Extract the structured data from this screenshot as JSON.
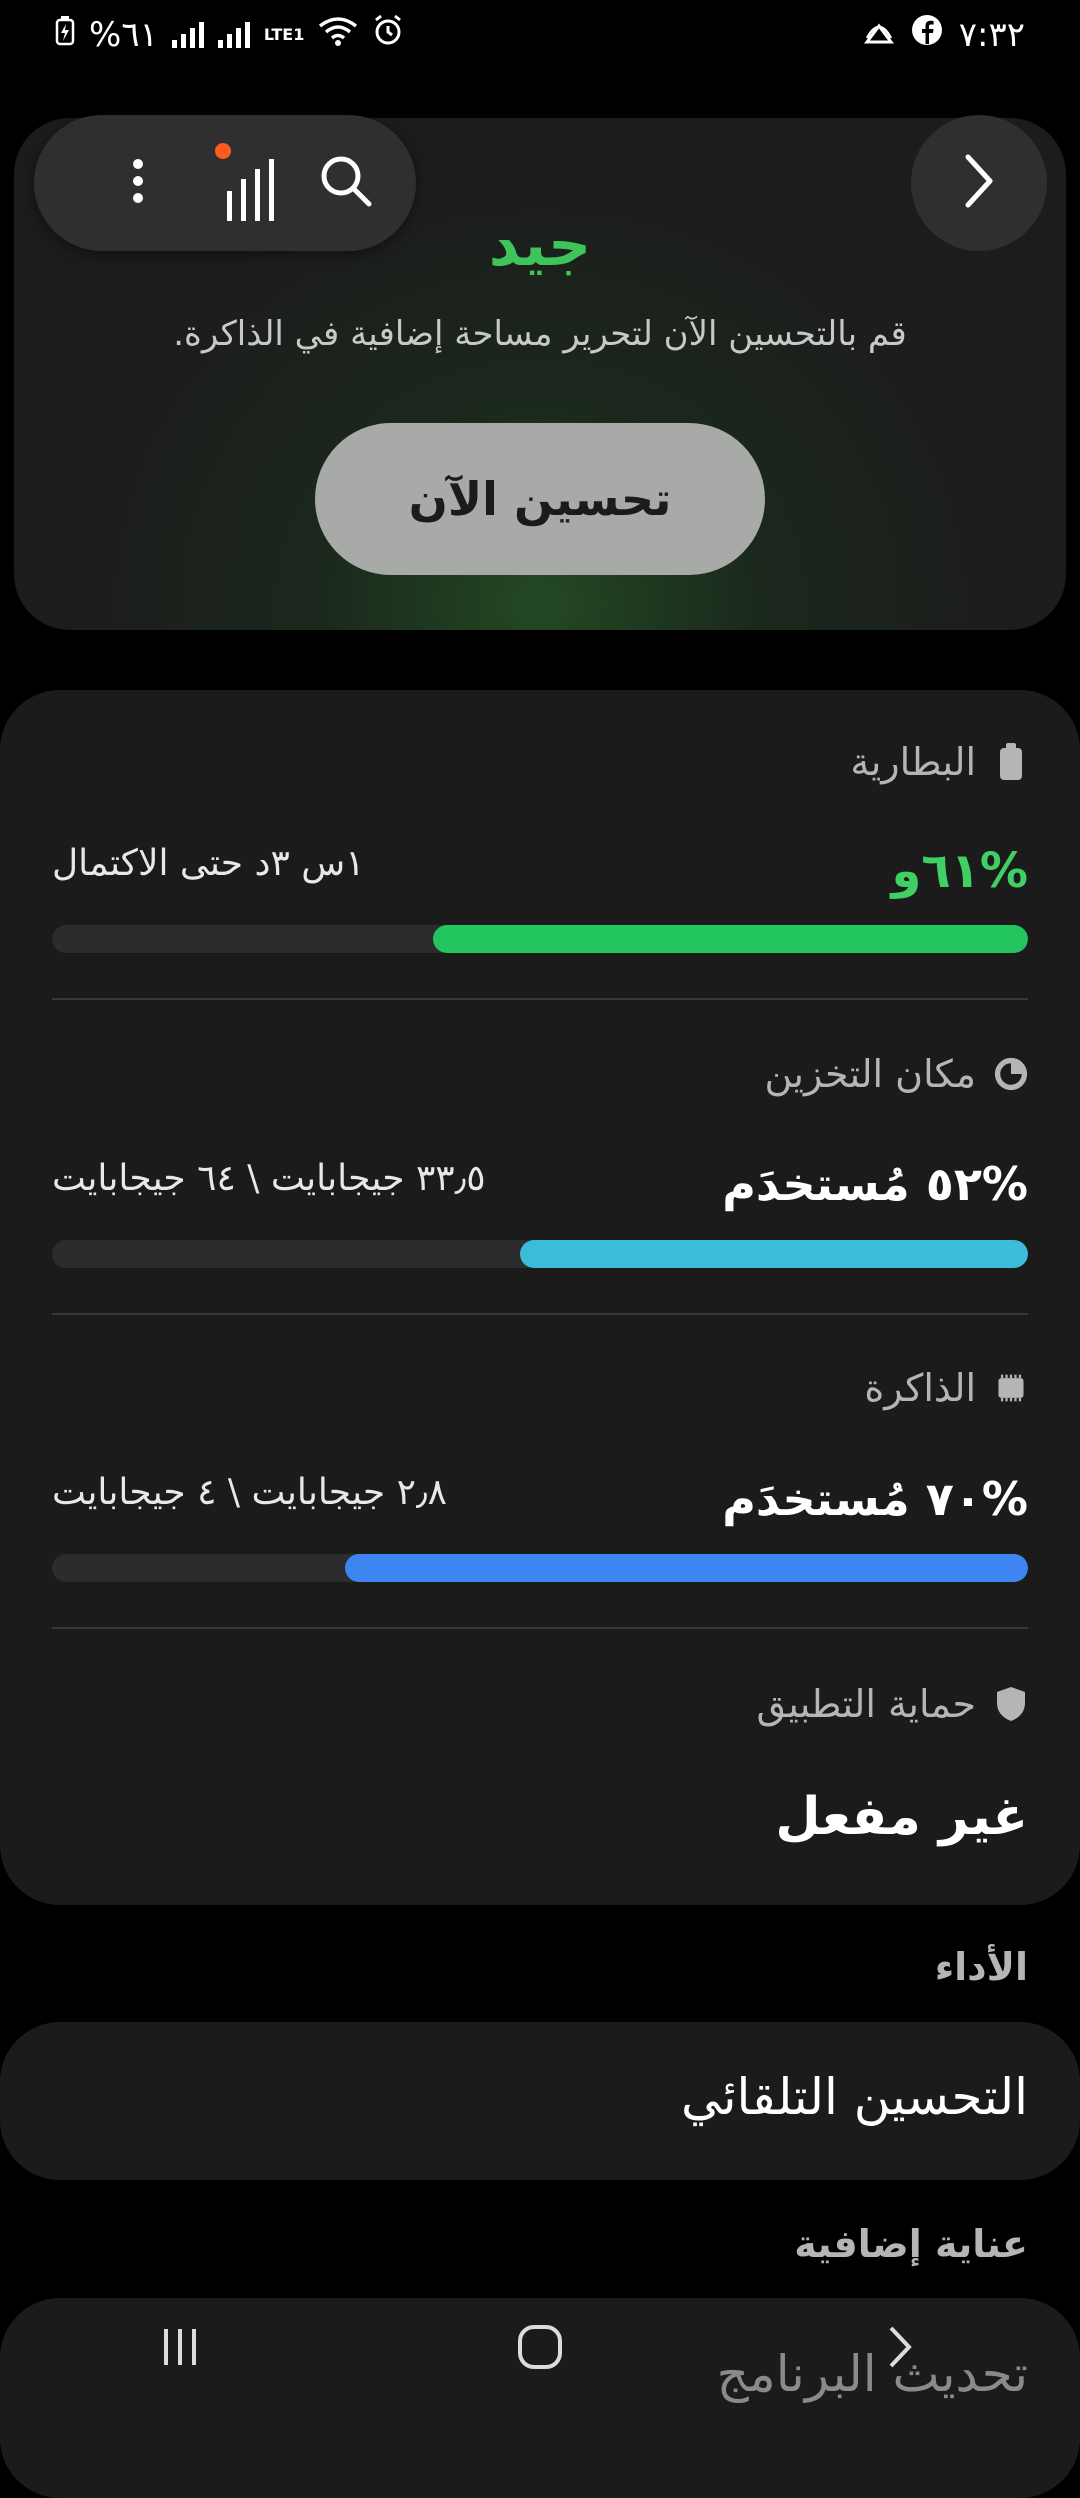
{
  "status_bar": {
    "time": "٧:٣٢",
    "battery_percent": "%٦١",
    "network": "LTE1"
  },
  "header": {
    "status": "جيد",
    "hint": "قم بالتحسين الآن لتحرير مساحة إضافية في الذاكرة.",
    "optimize_button": "تحسين الآن"
  },
  "icons": {
    "more": "more-vert-icon",
    "stats": "stats-icon",
    "search": "search-icon",
    "forward": "chevron-right-icon"
  },
  "battery": {
    "title": "البطارية",
    "percent": "%٦١ﻭ",
    "remaining": "١س ٣د حتى الاكتمال",
    "level": 0.61,
    "color": "#22c55e"
  },
  "storage": {
    "title": "مكان التخزين",
    "used": "%٥٢ مُستخدَم",
    "detail": "٣٣٫٥ جيجابايت \\ ٦٤ جيجابايت",
    "level": 0.52,
    "color": "#3bbcd9"
  },
  "memory": {
    "title": "الذاكرة",
    "used": "%٧٠ مُستخدَم",
    "detail": "٢٫٨ جيجابايت \\ ٤ جيجابايت",
    "level": 0.7,
    "color": "#3d86f2"
  },
  "app_protection": {
    "title": "حماية التطبيق",
    "value": "غير مفعل"
  },
  "performance": {
    "title": "الأداء",
    "auto_optimize": "التحسين التلقائي"
  },
  "extra_care": {
    "title": "عناية إضافية",
    "software_update": "تحديث البرنامج"
  }
}
